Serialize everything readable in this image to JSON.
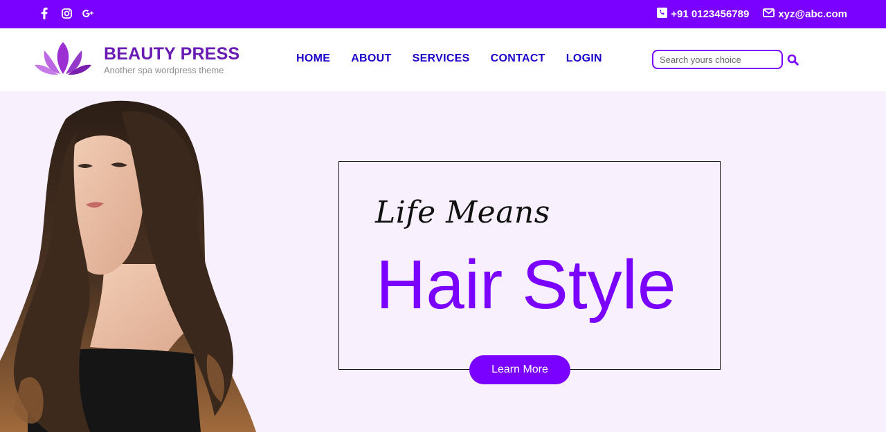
{
  "topbar": {
    "social": [
      {
        "icon": "facebook-icon"
      },
      {
        "icon": "instagram-icon"
      },
      {
        "icon": "google-plus-icon"
      }
    ],
    "phone": "+91 0123456789",
    "email": "xyz@abc.com",
    "background": "#7a00ff"
  },
  "header": {
    "brand": "BEAUTY PRESS",
    "tagline": "Another spa wordpress theme",
    "nav": [
      "HOME",
      "ABOUT",
      "SERVICES",
      "CONTACT",
      "LOGIN"
    ],
    "search_placeholder": "Search yours choice"
  },
  "hero": {
    "script_text": "Life Means",
    "headline": "Hair Style",
    "cta_label": "Learn More",
    "accent": "#7a00ff",
    "background": "#f8f0fd"
  }
}
